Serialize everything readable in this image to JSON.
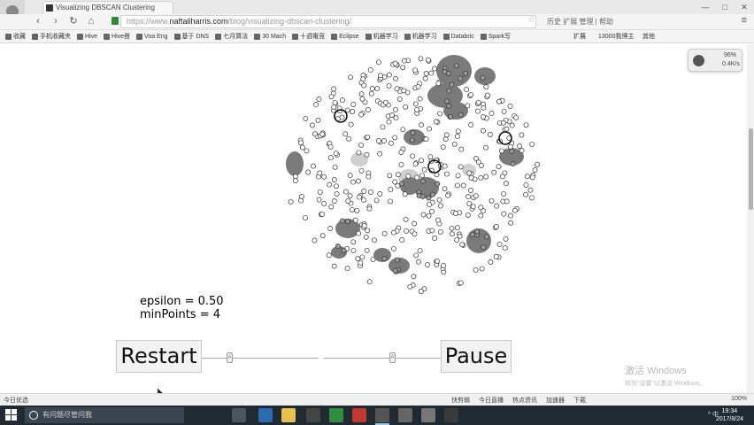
{
  "browser": {
    "tab_title": "Visualizing DBSCAN Clustering",
    "url_prefix": "https://www.",
    "url_host": "naftaliharris.com",
    "url_path": "/blog/visualizing-dbscan-clustering/",
    "window_controls": [
      "—",
      "□",
      "✕"
    ],
    "toolbar_right_text": "历史 扩展 管理 | 帮助"
  },
  "bookmarks": {
    "items": [
      "收藏",
      "手机收藏夹",
      "Hive",
      "Hive搭",
      "Voa Eng",
      "基于 DNS",
      "七月算法",
      "30 Mach",
      "十週電竞",
      "Eclipse",
      "机器学习",
      "机器学习",
      "Databric",
      "Spark写"
    ],
    "right_items": [
      "扩展",
      "13000我博主",
      "其他"
    ]
  },
  "extension_badge": {
    "line1": "96%",
    "line2": "0.4K/s"
  },
  "params": {
    "epsilon": "epsilon = 0.50",
    "min_points": "minPoints = 4"
  },
  "buttons": {
    "restart": "Restart",
    "pause": "Pause"
  },
  "sliders": {
    "left_handle": "A",
    "right_handle": "A"
  },
  "watermark": {
    "line1": "激活 Windows",
    "line2": "转到\"设置\"以激活 Windows。"
  },
  "statusbar": {
    "left": "今日优选",
    "items": [
      "快剪辑",
      "今日直播",
      "热点资讯",
      "加速器",
      "下载"
    ],
    "zoom": "100%"
  },
  "taskbar": {
    "search_placeholder": "有问题尽管问我",
    "clock_time": "19:34",
    "clock_date": "2017/8/24",
    "tray_text": "^ 中"
  },
  "colors": {
    "cluster_fill": "#7a7a7a",
    "point_stroke": "#333333",
    "taskbar": "#1f2a33"
  }
}
